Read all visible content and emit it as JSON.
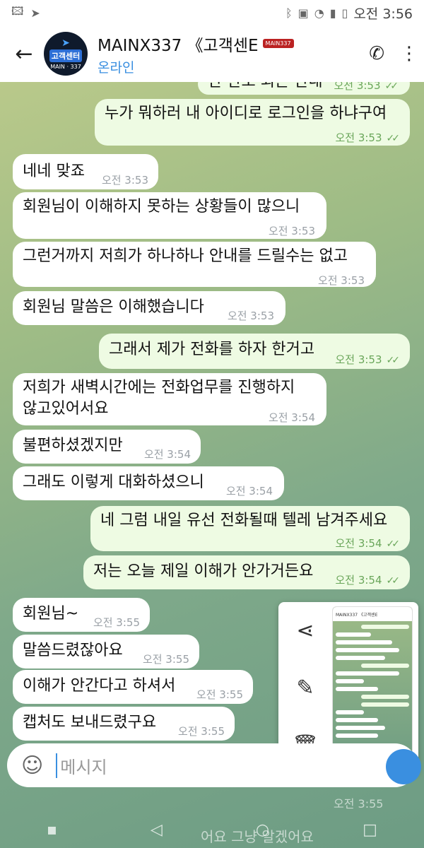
{
  "status": {
    "time": "오전 3:56",
    "icons": [
      "image-icon",
      "telegram-icon",
      "bluetooth-icon",
      "nfc-icon",
      "wifi-icon",
      "signal-icon",
      "battery-icon"
    ]
  },
  "header": {
    "back_icon": "←",
    "title": "MAINX337 《고객센E",
    "title_badge": "MAIN337",
    "subtitle": "온라인",
    "avatar_line1": "고객센터",
    "avatar_line2": "MAIN · 337",
    "phone_icon": "phone-icon",
    "menu_icon": "more-vert-icon"
  },
  "messages": [
    {
      "dir": "out",
      "text": "안 한도 되는 안내",
      "time": "오전 3:53",
      "read": true
    },
    {
      "dir": "out",
      "text": "누가 뭐하러 내 아이디로 로그인을 하냐구여",
      "time": "오전 3:53",
      "read": true
    },
    {
      "dir": "in",
      "text": "네네 맞죠",
      "time": "오전 3:53"
    },
    {
      "dir": "in",
      "text": "회원님이 이해하지 못하는 상황들이 많으니",
      "time": "오전 3:53"
    },
    {
      "dir": "in",
      "text": "그런거까지 저희가 하나하나 안내를 드릴수는 없고",
      "time": "오전 3:53"
    },
    {
      "dir": "in",
      "text": "회원님 말씀은 이해했습니다",
      "time": "오전 3:53"
    },
    {
      "dir": "out",
      "text": "그래서 제가 전화를 하자 한거고",
      "time": "오전 3:53",
      "read": true
    },
    {
      "dir": "in",
      "text": "저희가 새벽시간에는 전화업무를 진행하지 않고있어서요",
      "time": "오전 3:54"
    },
    {
      "dir": "in",
      "text": "불편하셨겠지만",
      "time": "오전 3:54"
    },
    {
      "dir": "in",
      "text": "그래도 이렇게 대화하셨으니",
      "time": "오전 3:54"
    },
    {
      "dir": "out",
      "text": "네 그럼 내일 유선 전화될때 텔레 남겨주세요",
      "time": "오전 3:54",
      "read": true
    },
    {
      "dir": "out",
      "text": "저는 오늘 제일 이해가 안가거든요",
      "time": "오전 3:54",
      "read": true
    },
    {
      "dir": "in",
      "text": "회원님~",
      "time": "오전 3:55"
    },
    {
      "dir": "in",
      "text": "말씀드렸잖아요",
      "time": "오전 3:55"
    },
    {
      "dir": "in",
      "text": "이해가 안간다고 하셔서",
      "time": "오전 3:55"
    },
    {
      "dir": "in",
      "text": "캡처도 보내드렸구요",
      "time": "오전 3:55"
    }
  ],
  "popup": {
    "actions": [
      "share-icon",
      "edit-icon",
      "delete-icon"
    ],
    "thumb_title": "MAINX337 《고객센E"
  },
  "input": {
    "placeholder": "메시지",
    "emoji_icon": "emoji-icon"
  },
  "faded": {
    "time": "오전 3:55",
    "text": "어요 그냥 알겠어요"
  },
  "colors": {
    "incoming": "#ffffff",
    "outgoing": "#eefbe3",
    "accent": "#3a8fe0",
    "check": "#6aa65a"
  }
}
